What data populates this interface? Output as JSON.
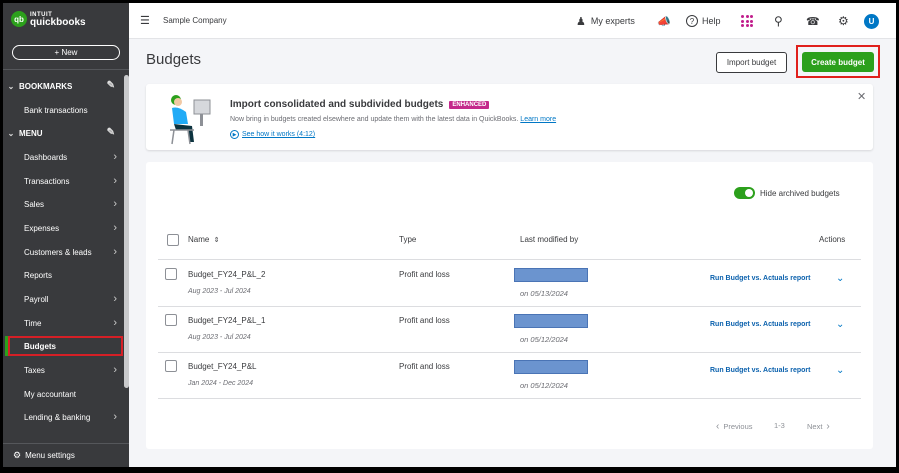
{
  "app": {
    "logo_line1": "INTUIT",
    "logo_line2": "quickbooks",
    "logo_mark": "qb",
    "new_button": "+ New"
  },
  "sidebar": {
    "bookmarks_label": "BOOKMARKS",
    "bookmarks_items": [
      {
        "label": "Bank transactions"
      }
    ],
    "menu_label": "MENU",
    "menu_items": [
      {
        "label": "Dashboards",
        "has_arrow": true
      },
      {
        "label": "Transactions",
        "has_arrow": true
      },
      {
        "label": "Sales",
        "has_arrow": true
      },
      {
        "label": "Expenses",
        "has_arrow": true
      },
      {
        "label": "Customers & leads",
        "has_arrow": true
      },
      {
        "label": "Reports",
        "has_arrow": false
      },
      {
        "label": "Payroll",
        "has_arrow": true
      },
      {
        "label": "Time",
        "has_arrow": true
      },
      {
        "label": "Budgets",
        "has_arrow": false,
        "active": true
      },
      {
        "label": "Taxes",
        "has_arrow": true
      },
      {
        "label": "My accountant",
        "has_arrow": false
      },
      {
        "label": "Lending & banking",
        "has_arrow": true
      }
    ],
    "menu_settings": "Menu settings"
  },
  "topbar": {
    "company": "Sample Company",
    "my_experts": "My experts",
    "help": "Help",
    "avatar_initial": "U"
  },
  "page": {
    "title": "Budgets",
    "import_button": "Import budget",
    "create_button": "Create budget"
  },
  "banner": {
    "title": "Import consolidated and subdivided budgets",
    "badge": "ENHANCED",
    "subtitle": "Now bring in budgets created elsewhere and update them with the latest data in QuickBooks.",
    "learn_more": "Learn more",
    "video_link": "See how it works (4:12)"
  },
  "table": {
    "toggle_label": "Hide archived budgets",
    "toggle_on": true,
    "headers": {
      "name": "Name",
      "type": "Type",
      "modified": "Last modified by",
      "actions": "Actions"
    },
    "rows": [
      {
        "name": "Budget_FY24_P&L_2",
        "period": "Aug 2023 - Jul 2024",
        "type": "Profit and loss",
        "modified": "on 05/13/2024",
        "action": "Run Budget vs. Actuals report"
      },
      {
        "name": "Budget_FY24_P&L_1",
        "period": "Aug 2023 - Jul 2024",
        "type": "Profit and loss",
        "modified": "on 05/12/2024",
        "action": "Run Budget vs. Actuals report"
      },
      {
        "name": "Budget_FY24_P&L",
        "period": "Jan 2024 - Dec 2024",
        "type": "Profit and loss",
        "modified": "on 05/12/2024",
        "action": "Run Budget vs. Actuals report"
      }
    ],
    "pager": {
      "previous": "Previous",
      "range": "1-3",
      "next": "Next"
    }
  },
  "colors": {
    "brand_green": "#2ca01c",
    "sidebar_bg": "#393a3d",
    "link_blue": "#0077c5",
    "highlight_red": "#e0201c",
    "badge_magenta": "#c4298b"
  }
}
